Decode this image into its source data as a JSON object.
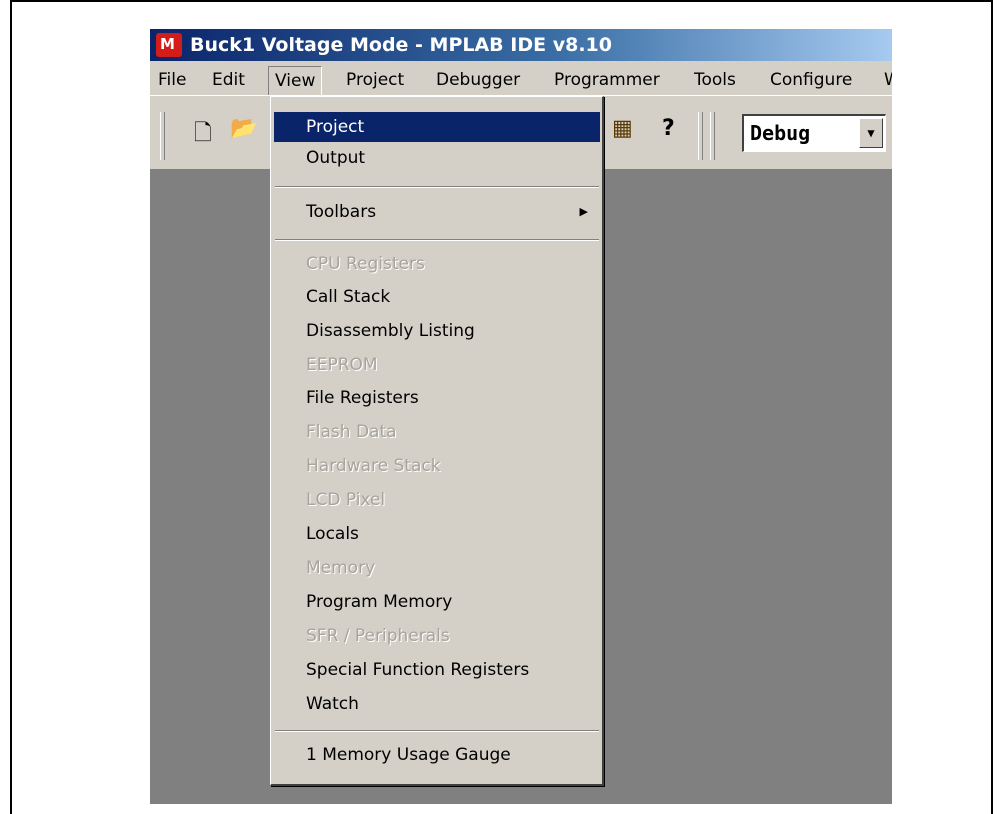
{
  "window": {
    "title": "Buck1 Voltage Mode - MPLAB IDE v8.10"
  },
  "menubar": {
    "file": "File",
    "edit": "Edit",
    "view": "View",
    "project": "Project",
    "debugger": "Debugger",
    "programmer": "Programmer",
    "tools": "Tools",
    "configure": "Configure",
    "window": "W"
  },
  "toolbar": {
    "config_select": "Debug",
    "help_glyph": "?"
  },
  "view_menu": {
    "project": "Project",
    "output": "Output",
    "toolbars": "Toolbars",
    "cpu_registers": "CPU Registers",
    "call_stack": "Call Stack",
    "disassembly_listing": "Disassembly Listing",
    "eeprom": "EEPROM",
    "file_registers": "File Registers",
    "flash_data": "Flash Data",
    "hardware_stack": "Hardware Stack",
    "lcd_pixel": "LCD Pixel",
    "locals": "Locals",
    "memory": "Memory",
    "program_memory": "Program Memory",
    "sfr_peripherals": "SFR / Peripherals",
    "special_function_registers": "Special Function Registers",
    "watch": "Watch",
    "memory_usage_gauge": "1 Memory Usage Gauge"
  },
  "colors": {
    "highlight": "#0a246a",
    "face": "#d4d0c8",
    "workspace": "#808080"
  }
}
